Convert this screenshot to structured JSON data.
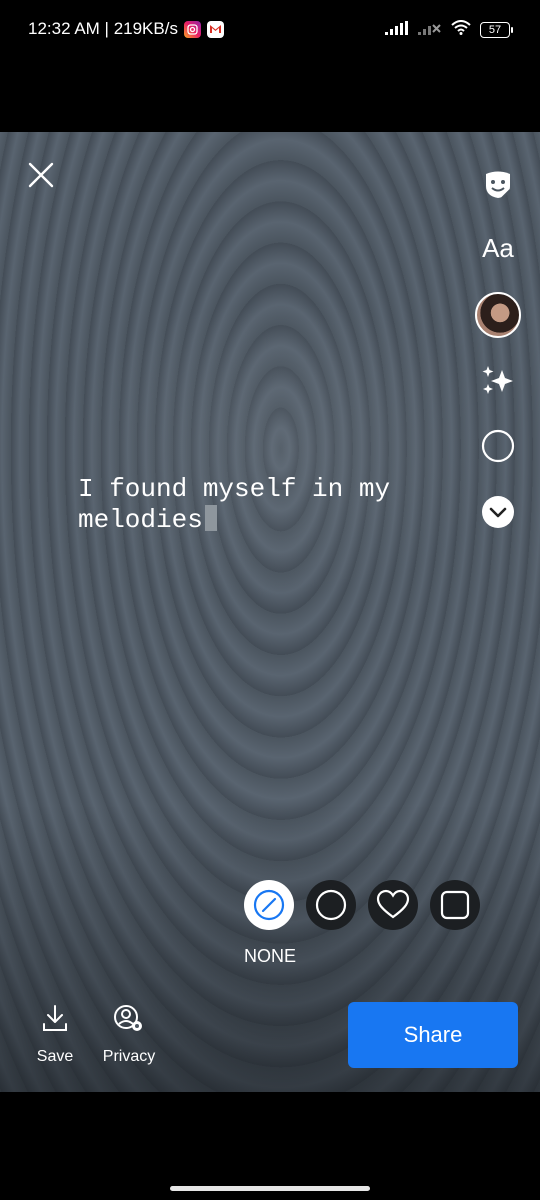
{
  "status_bar": {
    "time_speed": "12:32 AM | 219KB/s",
    "battery": "57",
    "icons": [
      "instagram-icon",
      "gmail-icon",
      "signal-icon",
      "signal-x-icon",
      "wifi-icon",
      "battery-icon"
    ]
  },
  "editor": {
    "story_text": "I found myself in my\nmelodies",
    "tools": {
      "text_tool_label": "Aa",
      "icons": [
        "sticker-icon",
        "text-icon",
        "avatar",
        "effects-sparkle-icon",
        "circle-icon",
        "chevron-down-icon"
      ]
    },
    "frames": {
      "selected_label": "NONE",
      "options": [
        "none",
        "circle",
        "heart",
        "square"
      ]
    }
  },
  "bottom_bar": {
    "save_label": "Save",
    "privacy_label": "Privacy",
    "share_label": "Share"
  },
  "colors": {
    "share_button": "#1877f2",
    "background_dark": "#4b555f"
  }
}
